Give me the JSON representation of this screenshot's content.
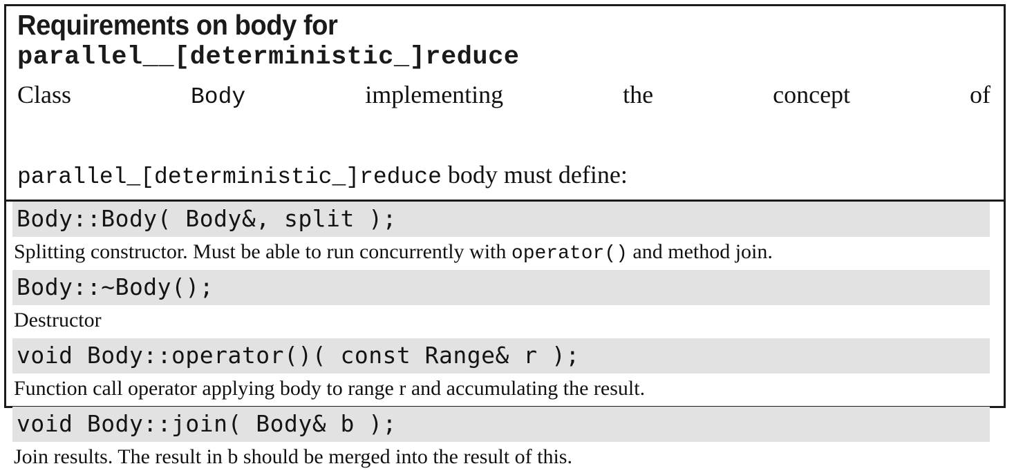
{
  "figure": {
    "title_line_1": "Requirements on body for",
    "title_line_2": "parallel__[deterministic_]reduce",
    "intro": {
      "part_1": "Class",
      "code_1": "Body",
      "part_2": "implementing",
      "part_3": "the",
      "part_4": "concept",
      "part_5": "of",
      "code_2": "parallel_[deterministic_]reduce",
      "part_6": "body must define:"
    },
    "colors": {
      "border": "#1a1a1a",
      "signature_background": "#e2e2e2",
      "text": "#111111",
      "page_background": "#ffffff"
    },
    "rows": [
      {
        "signature": "Body::Body( Body&, split );",
        "description_pre": "Splitting constructor. Must be able to run concurrently with ",
        "description_code": "operator()",
        "description_post": " and method join."
      },
      {
        "signature": "Body::~Body();",
        "description_pre": "Destructor",
        "description_code": "",
        "description_post": ""
      },
      {
        "signature": "void Body::operator()( const Range& r );",
        "description_pre": "Function call operator applying body to range r and accumulating the result.",
        "description_code": "",
        "description_post": ""
      },
      {
        "signature": "void Body::join( Body& b );",
        "description_pre": "Join results. The result in b should be merged into the result of this.",
        "description_code": "",
        "description_post": ""
      }
    ]
  }
}
